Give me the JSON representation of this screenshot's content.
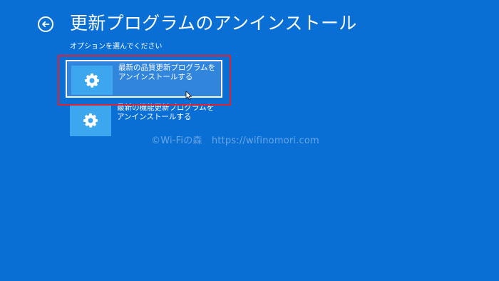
{
  "header": {
    "title": "更新プログラムのアンインストール",
    "back_icon": "back-arrow-icon"
  },
  "subtitle": "オプションを選んでください",
  "options": [
    {
      "label": "最新の品質更新プログラムをアンインストールする",
      "icon": "gear-icon",
      "selected": true
    },
    {
      "label": "最新の機能更新プログラムをアンインストールする",
      "icon": "gear-icon",
      "selected": false
    }
  ],
  "watermark": "©Wi-Fiの森　https://wifinomori.com",
  "colors": {
    "background": "#0a6fd4",
    "tile": "#3ca7ee",
    "highlight": "#e0232f",
    "text": "#ffffff"
  }
}
